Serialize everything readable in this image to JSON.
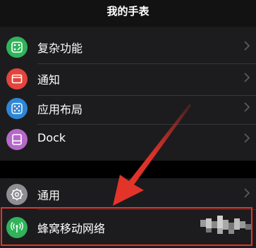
{
  "header": {
    "title": "我的手表"
  },
  "menu": {
    "items": [
      {
        "label": "复杂功能",
        "icon": "complications-icon",
        "color": "#30b35a"
      },
      {
        "label": "通知",
        "icon": "notifications-icon",
        "color": "#e3443c"
      },
      {
        "label": "应用布局",
        "icon": "app-layout-icon",
        "color": "#2f86d6"
      },
      {
        "label": "Dock",
        "icon": "dock-icon",
        "color": "#b668c9"
      },
      {
        "label": "通用",
        "icon": "gear-icon",
        "color": "#8e8e93"
      },
      {
        "label": "蜂窝移动网络",
        "icon": "cellular-icon",
        "color": "#30b35a"
      }
    ]
  },
  "annotation": {
    "highlight_color": "#e6342a"
  }
}
